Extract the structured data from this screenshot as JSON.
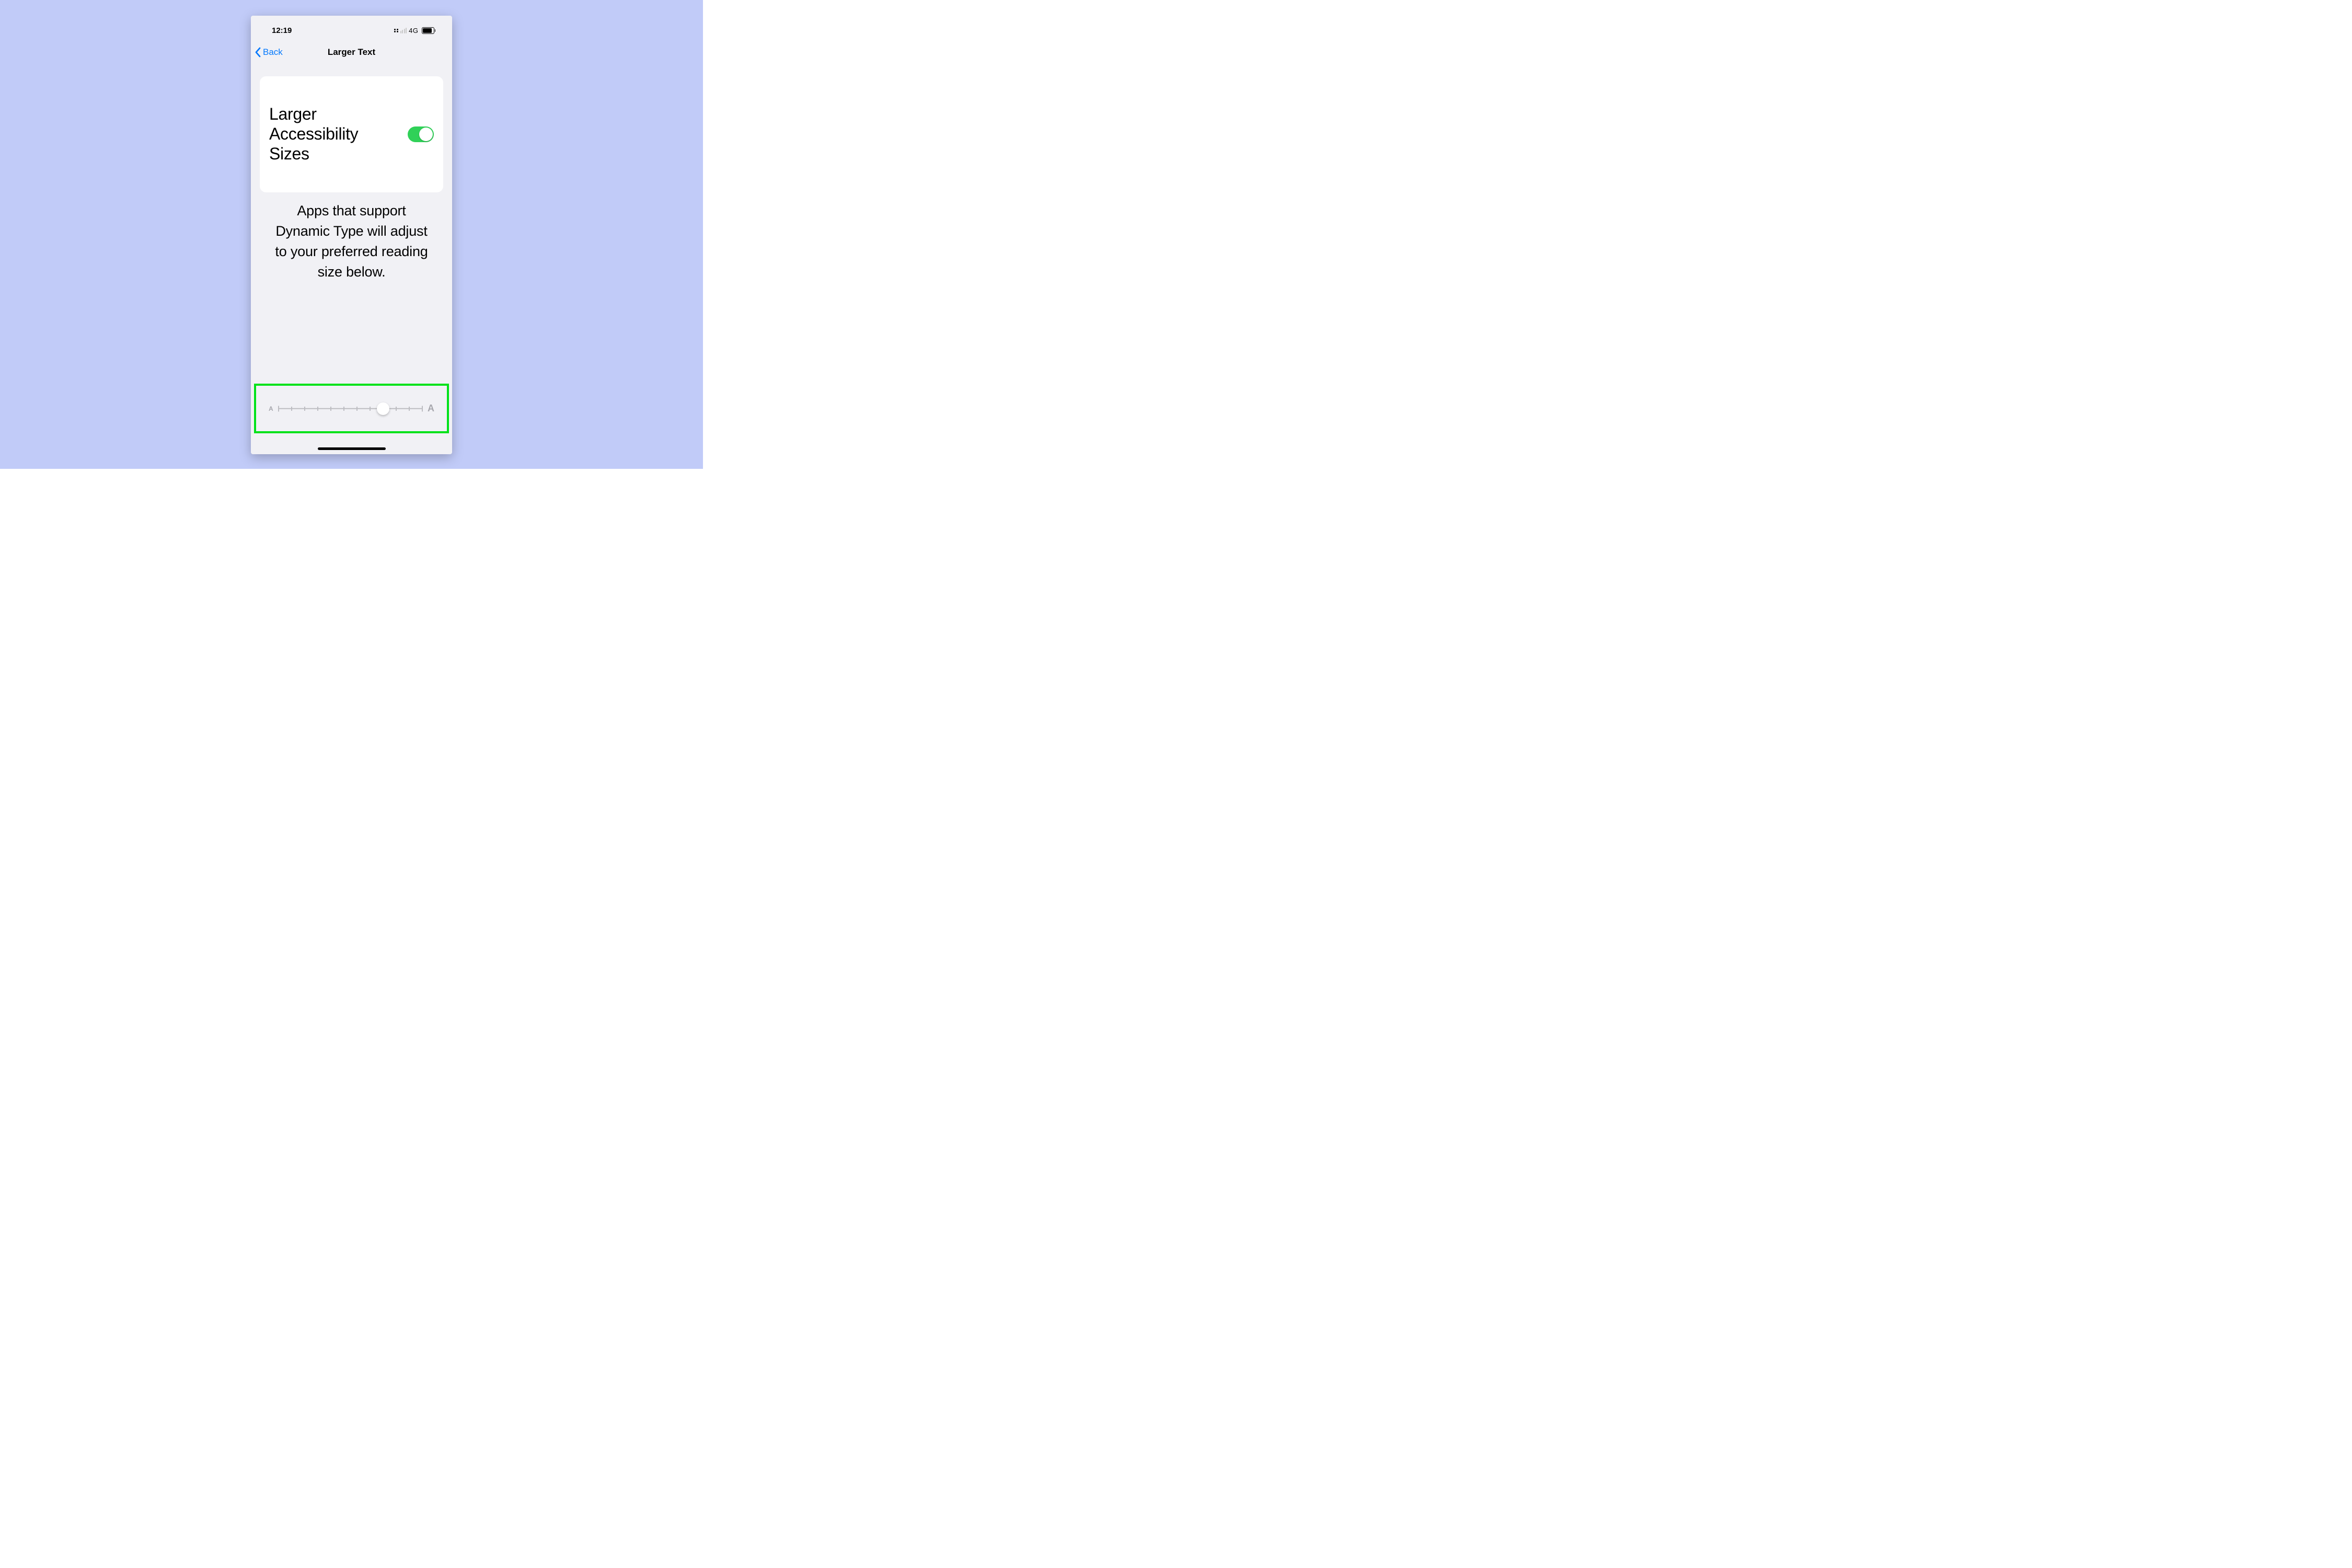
{
  "status_bar": {
    "time": "12:19",
    "network_label": "4G"
  },
  "nav": {
    "back_label": "Back",
    "title": "Larger Text"
  },
  "card": {
    "label": "Larger Accessibility Sizes",
    "toggle_on": true
  },
  "description": "Apps that support Dynamic Type will adjust to your preferred reading size below.",
  "slider": {
    "small_label": "A",
    "large_label": "A",
    "ticks": 12,
    "value_index": 8
  },
  "highlight_color": "#00e21a"
}
